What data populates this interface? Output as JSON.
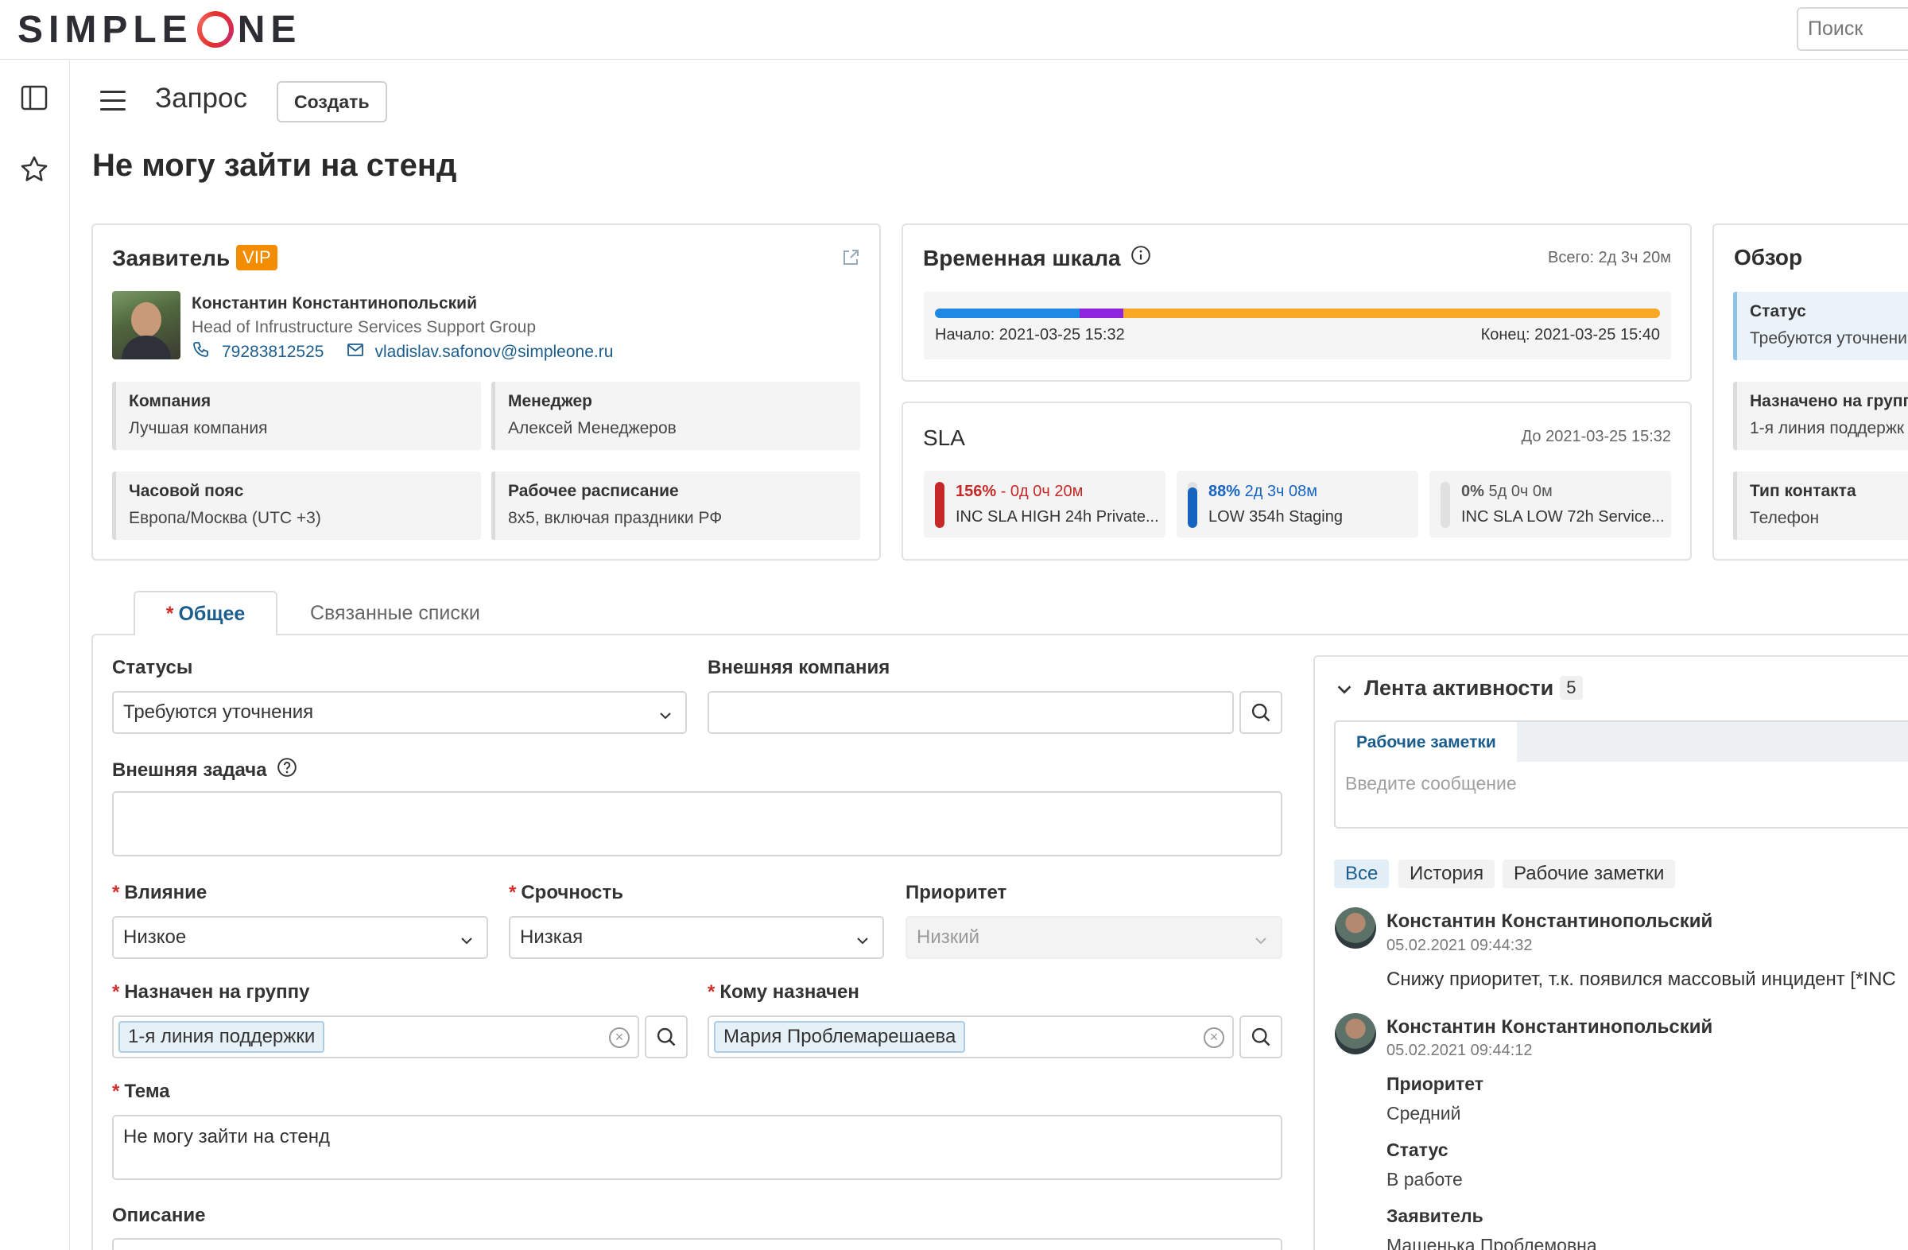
{
  "header": {
    "logo_text": "SIMPLEONE",
    "search_placeholder": "Поиск"
  },
  "page": {
    "kind": "Запрос",
    "create_label": "Создать",
    "title": "Не могу зайти на стенд"
  },
  "requester": {
    "heading": "Заявитель",
    "badge": "VIP",
    "name": "Константин Константинопольский",
    "position": "Head of Infrustructure Services Support Group",
    "phone": "79283812525",
    "email": "vladislav.safonov@simpleone.ru",
    "fields": [
      {
        "label": "Компания",
        "value": "Лучшая компания"
      },
      {
        "label": "Менеджер",
        "value": "Алексей Менеджеров"
      },
      {
        "label": "Часовой пояс",
        "value": "Европа/Москва (UTC +3)"
      },
      {
        "label": "Рабочее расписание",
        "value": "8х5, включая праздники РФ"
      }
    ]
  },
  "timeline": {
    "heading": "Временная шкала",
    "total": "Всего: 2д 3ч 20м",
    "start": "Начало: 2021-03-25 15:32",
    "end": "Конец: 2021-03-25 15:40",
    "segments": [
      {
        "share": 0.2,
        "color": "#1e88e5"
      },
      {
        "share": 0.06,
        "color": "#8e24dd"
      },
      {
        "share": 0.74,
        "color": "#f9a825"
      }
    ]
  },
  "sla": {
    "heading": "SLA",
    "deadline": "До 2021-03-25 15:32",
    "items": [
      {
        "pct": "156%",
        "time": "- 0д 0ч 20м",
        "name": "INC SLA HIGH 24h Private...",
        "fill": 1.0,
        "color": "#c62828",
        "text_color": "#c62828"
      },
      {
        "pct": "88%",
        "time": "2д 3ч 08м",
        "name": "LOW 354h Staging",
        "fill": 0.88,
        "color": "#1565c0",
        "text_color": "#1565c0"
      },
      {
        "pct": "0%",
        "time": "5д 0ч 0м",
        "name": "INC SLA LOW 72h Service...",
        "fill": 0.0,
        "color": "#bdbdbd",
        "text_color": "#555555"
      }
    ]
  },
  "overview": {
    "heading": "Обзор",
    "items": [
      {
        "label": "Статус",
        "value": "Требуются уточнени"
      },
      {
        "label": "Назначено на групп",
        "value": "1-я линия поддержк"
      },
      {
        "label": "Тип контакта",
        "value": "Телефон"
      }
    ]
  },
  "tabs": {
    "general": "Общее",
    "related": "Связанные списки"
  },
  "form": {
    "status_label": "Статусы",
    "status_value": "Требуются уточнения",
    "ext_company_label": "Внешняя компания",
    "ext_task_label": "Внешняя задача",
    "impact_label": "Влияние",
    "impact_value": "Низкое",
    "urgency_label": "Срочность",
    "urgency_value": "Низкая",
    "priority_label": "Приоритет",
    "priority_value": "Низкий",
    "group_label": "Назначен на группу",
    "group_value": "1-я линия поддержки",
    "assignee_label": "Кому назначен",
    "assignee_value": "Мария Проблемарешаева",
    "subject_label": "Тема",
    "subject_value": "Не могу зайти на стенд",
    "description_label": "Описание"
  },
  "feed": {
    "heading": "Лента активности",
    "count": "5",
    "compose_tab": "Рабочие заметки",
    "compose_placeholder": "Введите сообщение",
    "filters": [
      "Все",
      "История",
      "Рабочие заметки"
    ],
    "entries": [
      {
        "author": "Константин Константинопольский",
        "time": "05.02.2021 09:44:32",
        "text": "Снижу приоритет, т.к. появился массовый инцидент [*INC"
      },
      {
        "author": "Константин Константинопольский",
        "time": "05.02.2021 09:44:12",
        "changes": [
          {
            "field": "Приоритет",
            "value": "Средний"
          },
          {
            "field": "Статус",
            "value": "В работе"
          },
          {
            "field": "Заявитель",
            "value": "Машенька Проблемовна"
          }
        ]
      }
    ]
  },
  "colors": {
    "accent": "#1b5d8d",
    "vip": "#f28c00",
    "required": "#d0302a",
    "link": "#1b5d8d"
  }
}
